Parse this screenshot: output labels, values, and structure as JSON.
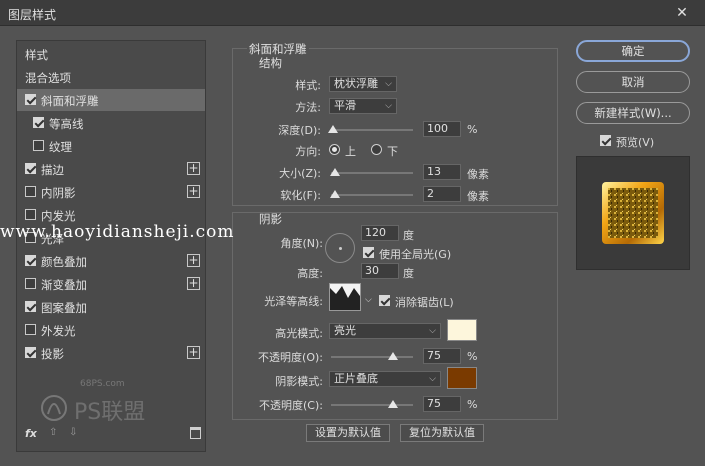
{
  "window": {
    "title": "图层样式",
    "close_glyph": "✕"
  },
  "left_panel": {
    "items": [
      {
        "label": "样式",
        "checkbox": false,
        "plus": false,
        "selected": false
      },
      {
        "label": "混合选项",
        "checkbox": false,
        "plus": false,
        "selected": false
      },
      {
        "label": "斜面和浮雕",
        "checkbox": true,
        "checked": true,
        "plus": false,
        "selected": true
      },
      {
        "label": "等高线",
        "checkbox": true,
        "checked": true,
        "plus": false,
        "selected": false,
        "sub": true
      },
      {
        "label": "纹理",
        "checkbox": true,
        "checked": false,
        "plus": false,
        "selected": false,
        "sub": true
      },
      {
        "label": "描边",
        "checkbox": true,
        "checked": true,
        "plus": true,
        "selected": false
      },
      {
        "label": "内阴影",
        "checkbox": true,
        "checked": false,
        "plus": true,
        "selected": false
      },
      {
        "label": "内发光",
        "checkbox": true,
        "checked": false,
        "plus": false,
        "selected": false
      },
      {
        "label": "光泽",
        "checkbox": true,
        "checked": false,
        "plus": false,
        "selected": false
      },
      {
        "label": "颜色叠加",
        "checkbox": true,
        "checked": true,
        "plus": true,
        "selected": false
      },
      {
        "label": "渐变叠加",
        "checkbox": true,
        "checked": false,
        "plus": true,
        "selected": false
      },
      {
        "label": "图案叠加",
        "checkbox": true,
        "checked": true,
        "plus": false,
        "selected": false
      },
      {
        "label": "外发光",
        "checkbox": true,
        "checked": false,
        "plus": false,
        "selected": false
      },
      {
        "label": "投影",
        "checkbox": true,
        "checked": true,
        "plus": true,
        "selected": false
      }
    ],
    "footer": {
      "fx": "fx",
      "up": "⇧",
      "down": "⇩"
    }
  },
  "bevel": {
    "section_title": "斜面和浮雕",
    "structure_title": "结构",
    "style_label": "样式:",
    "style_value": "枕状浮雕",
    "technique_label": "方法:",
    "technique_value": "平滑",
    "depth_label": "深度(D):",
    "depth_value": "100",
    "depth_unit": "%",
    "depth_level": 0.02,
    "direction_label": "方向:",
    "direction_up": "上",
    "direction_down": "下",
    "size_label": "大小(Z):",
    "size_value": "13",
    "size_unit": "像素",
    "size_level": 0.05,
    "soften_label": "软化(F):",
    "soften_value": "2",
    "soften_unit": "像素",
    "soften_level": 0.05
  },
  "shading": {
    "title": "阴影",
    "angle_label": "角度(N):",
    "angle_value": "120",
    "angle_unit": "度",
    "global_light_label": "使用全局光(G)",
    "altitude_label": "高度:",
    "altitude_value": "30",
    "altitude_unit": "度",
    "gloss_label": "光泽等高线:",
    "antialias_label": "消除锯齿(L)",
    "highlight_mode_label": "高光模式:",
    "highlight_mode_value": "亮光",
    "highlight_color": "#fdf6dc",
    "highlight_opacity_label": "不透明度(O):",
    "highlight_opacity_value": "75",
    "highlight_opacity_unit": "%",
    "highlight_opacity_level": 0.75,
    "shadow_mode_label": "阴影模式:",
    "shadow_mode_value": "正片叠底",
    "shadow_color": "#7a3a00",
    "shadow_opacity_label": "不透明度(C):",
    "shadow_opacity_value": "75",
    "shadow_opacity_unit": "%",
    "shadow_opacity_level": 0.75
  },
  "bottom_buttons": {
    "make_default": "设置为默认值",
    "reset_default": "复位为默认值"
  },
  "right_panel": {
    "ok": "确定",
    "cancel": "取消",
    "new_style": "新建样式(W)...",
    "preview_label": "预览(V)",
    "accent": "#8aa7d8"
  },
  "watermarks": {
    "site": "www.haoyidiansheji.com",
    "small": "68PS.com",
    "logo_text": "PS联盟"
  }
}
